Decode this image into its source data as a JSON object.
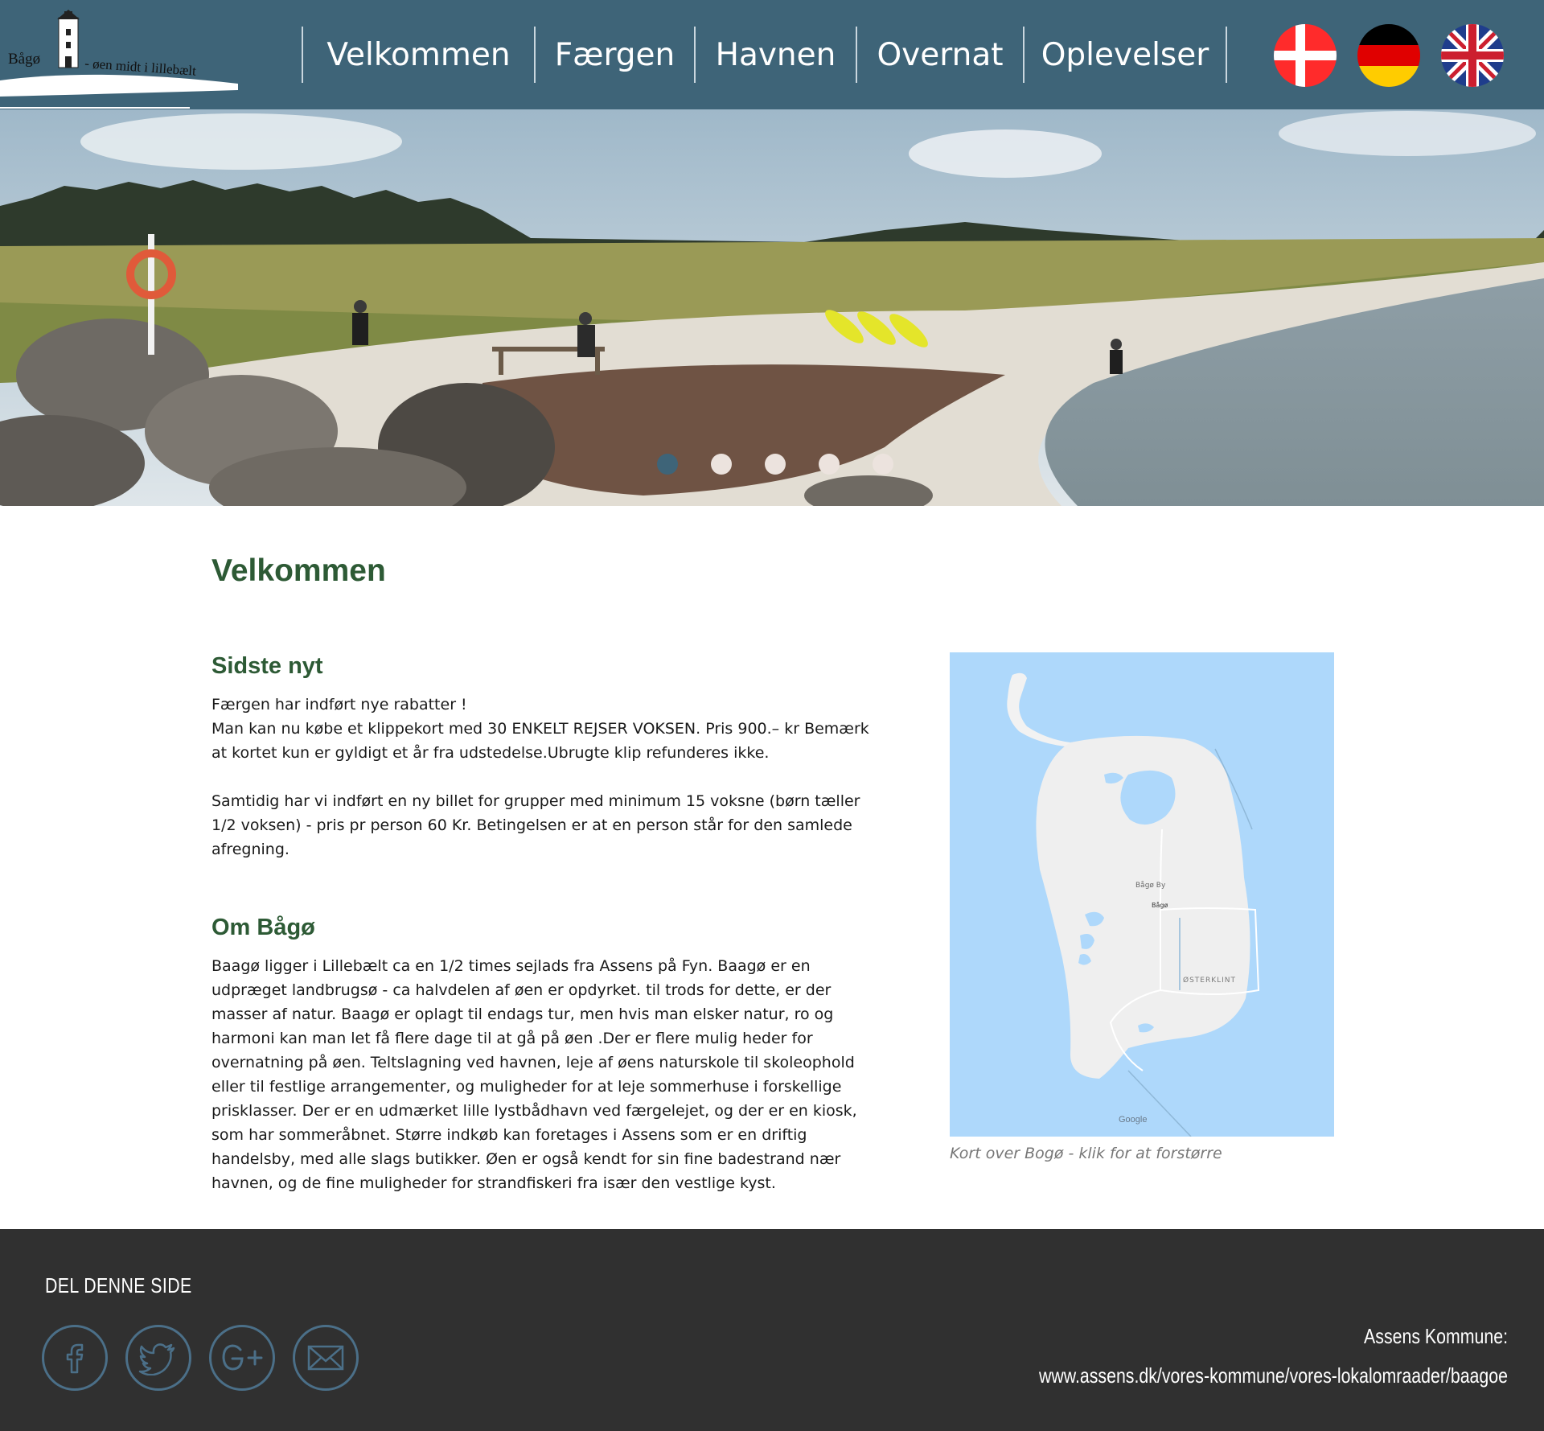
{
  "header": {
    "logo": {
      "name": "Bågø",
      "tagline": "- øen midt i lillebælt"
    },
    "nav": [
      {
        "label": "Velkommen"
      },
      {
        "label": "Færgen"
      },
      {
        "label": "Havnen"
      },
      {
        "label": "Overnat"
      },
      {
        "label": "Oplevelser"
      }
    ],
    "languages": [
      {
        "icon": "denmark-flag-icon"
      },
      {
        "icon": "germany-flag-icon"
      },
      {
        "icon": "uk-flag-icon"
      }
    ]
  },
  "hero": {
    "slide_count": 5,
    "active_slide": 1
  },
  "main": {
    "page_title": "Velkommen",
    "news": {
      "heading": "Sidste nyt",
      "line1": "Færgen har indført nye rabatter !",
      "line2": "Man kan nu købe et klippekort med 30 ENKELT REJSER VOKSEN. Pris 900.– kr Bemærk at kortet kun er gyldigt et år fra udstedelse.Ubrugte klip refunderes ikke.",
      "line3": "Samtidig har vi indført en ny billet for grupper med minimum 15 voksne (børn tæller 1/2 voksen) -  pris pr person 60 Kr. Betingelsen er at en person står for den samlede afregning."
    },
    "about": {
      "heading": "Om Bågø",
      "text": "Baagø ligger i Lillebælt ca en 1/2 times sejlads fra Assens på Fyn. Baagø er en udpræget landbrugsø - ca halvdelen af øen er opdyrket. til trods for dette, er der masser af natur. Baagø er oplagt til endags tur, men hvis man elsker natur, ro og harmoni kan man let få flere dage til at gå på øen .Der er flere mulig heder for overnatning på øen. Teltslagning ved havnen, leje af øens naturskole til skoleophold eller til festlige arrangementer, og muligheder for at leje sommerhuse i forskellige prisklasser. Der er en udmærket lille lystbådhavn ved færgelejet, og der er en kiosk, som har sommeråbnet.  Større indkøb kan foretages i Assens som er en driftig handelsby, med alle slags butikker. Øen er også kendt for sin fine badestrand nær havnen, og de fine muligheder for strandfiskeri fra især den vestlige kyst."
    },
    "map": {
      "label_town": "Bågø By",
      "label_place": "Bågø",
      "label_area": "ØSTERKLINT",
      "provider": "Google",
      "caption": "Kort over Bogø - klik for at forstørre"
    }
  },
  "footer": {
    "share_title": "DEL DENNE SIDE",
    "social": [
      {
        "icon": "facebook-icon"
      },
      {
        "icon": "twitter-icon"
      },
      {
        "icon": "google-plus-icon"
      },
      {
        "icon": "mail-icon"
      }
    ],
    "kommune_label": "Assens Kommune:",
    "kommune_link": "www.assens.dk/vores-kommune/vores-lokalomraader/baagoe"
  },
  "colors": {
    "header_bg": "#3e6478",
    "heading_green": "#2d5a35",
    "footer_bg": "#303030",
    "map_water": "#aed8fb"
  }
}
